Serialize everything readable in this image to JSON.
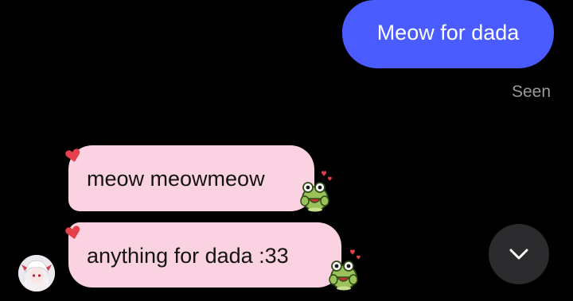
{
  "messages": {
    "outgoing": [
      {
        "text": "Meow for dada"
      }
    ],
    "outgoing_status": "Seen",
    "incoming": [
      {
        "text": "meow meowmeow",
        "reaction": "heart-icon",
        "sticker": "frog-sticker-icon"
      },
      {
        "text": "anything for dada :33",
        "reaction": "heart-icon",
        "sticker": "frog-sticker-icon"
      }
    ]
  },
  "colors": {
    "background": "#000000",
    "outgoing_bubble": "#4a5cff",
    "incoming_bubble": "#fbd2e1",
    "heart": "#e5414b",
    "seen_text": "#9a9a9a",
    "scroll_button": "#2b2b2d"
  },
  "controls": {
    "scroll_down_icon": "chevron-down-icon"
  },
  "avatar": {
    "icon": "anime-avatar-icon"
  }
}
